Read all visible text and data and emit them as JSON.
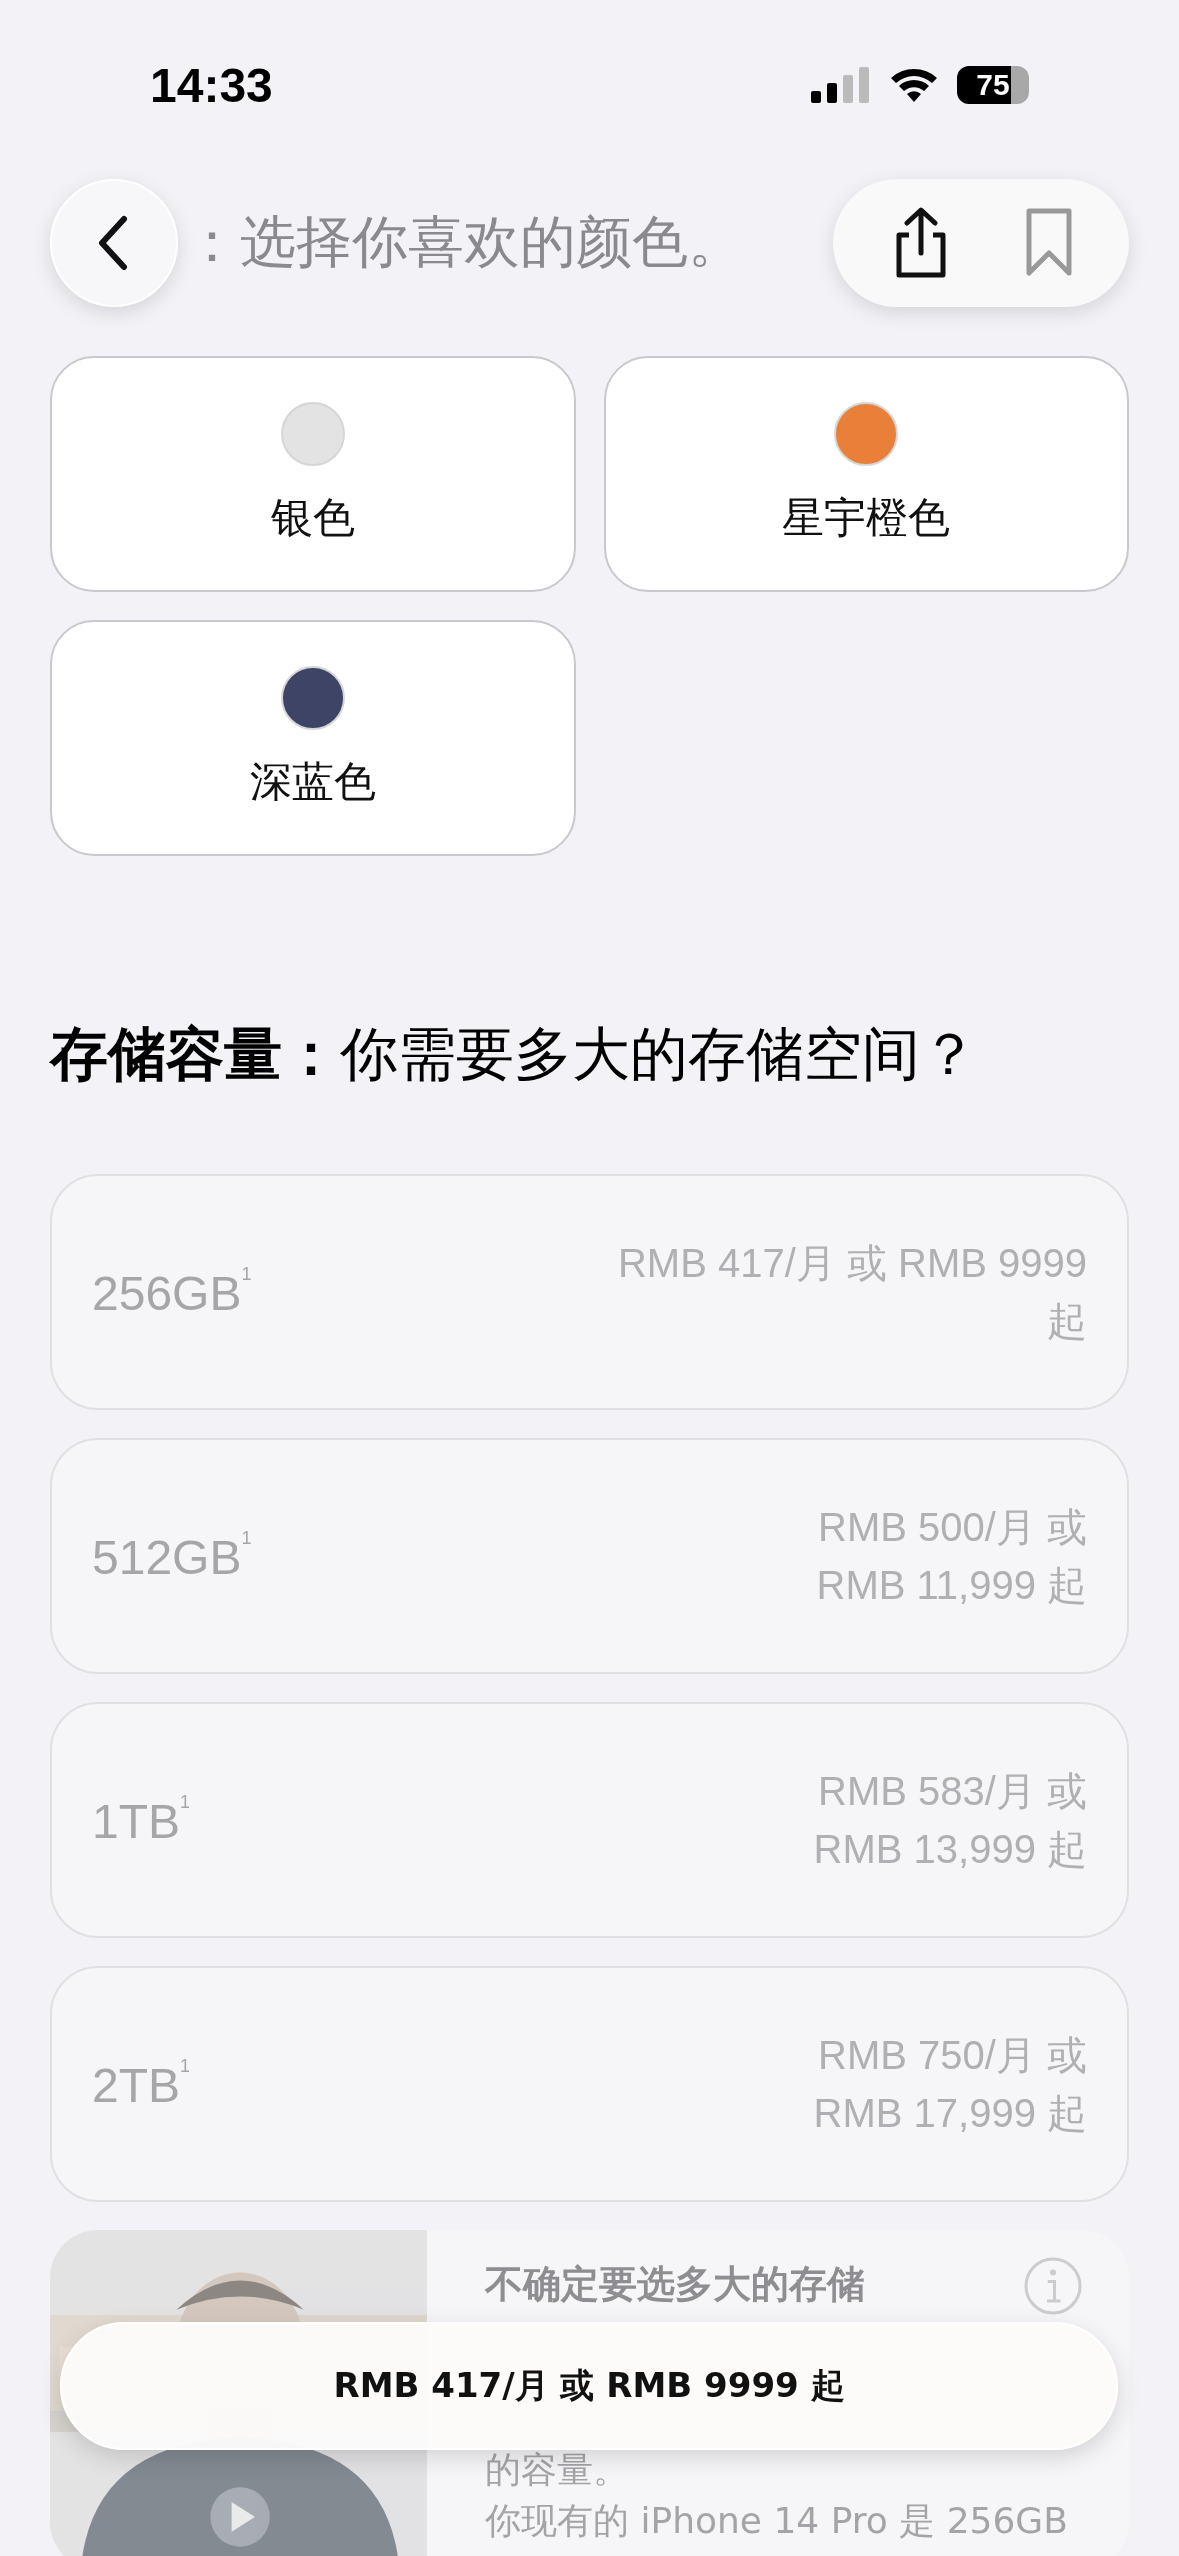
{
  "status_bar": {
    "time": "14:33",
    "battery": "75"
  },
  "nav": {
    "title": "：选择你喜欢的颜色。"
  },
  "colors": [
    {
      "name": "银色",
      "color": "#e3e3e3"
    },
    {
      "name": "星宇橙色",
      "color": "#e8803a"
    },
    {
      "name": "深蓝色",
      "color": "#3d4466"
    }
  ],
  "storage": {
    "heading": "**存储容量：**你需要多大的存储空间？",
    "options": [
      {
        "capacity": "256GB",
        "note": "1",
        "price": "RMB 417/月 或 RMB 9999 起"
      },
      {
        "capacity": "512GB",
        "note": "1",
        "price": "RMB 500/月 或 RMB 11,999 起"
      },
      {
        "capacity": "1TB",
        "note": "1",
        "price": "RMB 583/月 或 RMB 13,999 起"
      },
      {
        "capacity": "2TB",
        "note": "1",
        "price": "RMB 750/月 或 RMB 17,999 起"
      }
    ]
  },
  "help_card": {
    "kind": "picture",
    "title": "不确定要选多大的存储",
    "lines": [
      "的容量。",
      "你现有的 iPhone 14 Pro 是 256GB"
    ]
  },
  "price_bar": {
    "text": "RMB 417/月 或 RMB 9999 起"
  }
}
